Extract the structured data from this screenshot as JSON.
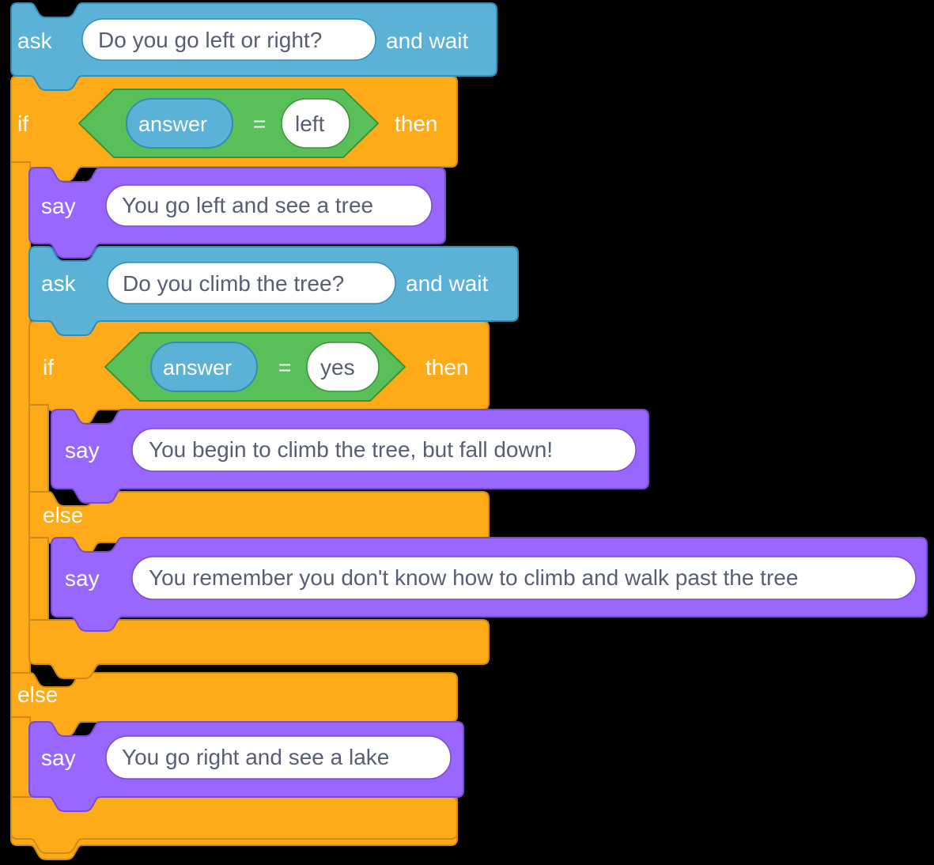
{
  "script": {
    "name": "scratch-adventure-script",
    "colors": {
      "sensing_blue": "#5CB1D6",
      "sensing_blue_stroke": "#2E8EB8",
      "control_orange": "#FFAB19",
      "control_orange_stroke": "#CF8B17",
      "looks_purple": "#9966FF",
      "looks_purple_stroke": "#774DCB",
      "operator_green": "#59C059",
      "operator_green_stroke": "#389438",
      "field_white": "#FFFFFF",
      "field_text": "#575E75",
      "label_text": "#FFFFFF",
      "background": "#000000"
    },
    "blocks": [
      {
        "id": "ask-1",
        "type": "sensing_askandwait",
        "label_prefix": "ask",
        "label_suffix": "and wait",
        "field_value": "Do you go left or right?",
        "depth": 0
      },
      {
        "id": "if-else-outer",
        "type": "control_if_else",
        "label_if": "if",
        "label_then": "then",
        "label_else": "else",
        "depth": 0,
        "condition": {
          "id": "equals-outer",
          "type": "operator_equals",
          "operator": "=",
          "left_reporter": "answer",
          "right_value": "left"
        }
      },
      {
        "id": "say-1",
        "type": "looks_say",
        "label_prefix": "say",
        "field_value": "You go left and see a tree",
        "depth": 1
      },
      {
        "id": "ask-2",
        "type": "sensing_askandwait",
        "label_prefix": "ask",
        "label_suffix": "and wait",
        "field_value": "Do you climb the tree?",
        "depth": 1
      },
      {
        "id": "if-else-inner",
        "type": "control_if_else",
        "label_if": "if",
        "label_then": "then",
        "label_else": "else",
        "depth": 1,
        "condition": {
          "id": "equals-inner",
          "type": "operator_equals",
          "operator": "=",
          "left_reporter": "answer",
          "right_value": "yes"
        }
      },
      {
        "id": "say-2",
        "type": "looks_say",
        "label_prefix": "say",
        "field_value": "You begin to climb the tree, but fall down!",
        "depth": 2
      },
      {
        "id": "say-3",
        "type": "looks_say",
        "label_prefix": "say",
        "field_value": "You remember you don't know how to climb and walk past the tree",
        "depth": 2
      },
      {
        "id": "say-4",
        "type": "looks_say",
        "label_prefix": "say",
        "field_value": "You go right and see a lake",
        "depth": 1
      }
    ]
  }
}
